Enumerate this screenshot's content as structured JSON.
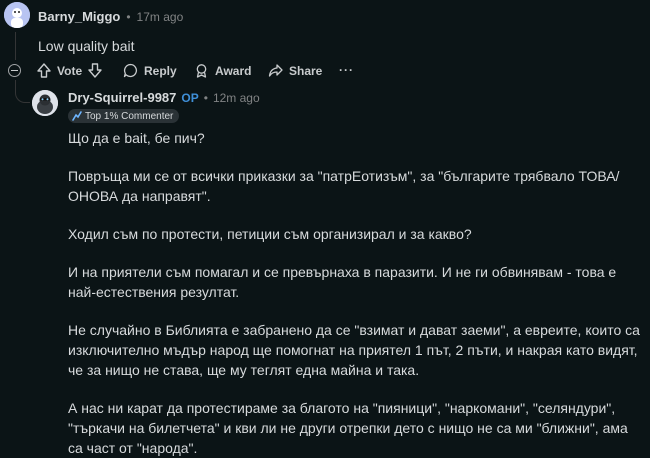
{
  "comment": {
    "author": "Barny_Miggo",
    "time": "17m ago",
    "body": "Low quality bait",
    "actions": {
      "vote": "Vote",
      "reply": "Reply",
      "award": "Award",
      "share": "Share",
      "more": "···"
    }
  },
  "reply": {
    "author": "Dry-Squirrel-9987",
    "op_badge": "OP",
    "time": "12m ago",
    "flair": "Top 1% Commenter",
    "paragraphs": [
      "Що да е bait, бе пич?",
      "Повръща ми се от всички приказки за \"патрЕотизъм\", за \"българите трябвало ТОВА/ОНОВА да направят\".",
      "Ходил съм по протести, петиции съм организирал и за какво?",
      "И на приятели съм помагал и се превърнаха в паразити. И не ги обвинявам - това е най-естествения резултат.",
      "Не случайно в Библията е забранено да се \"взимат и дават заеми\", а евреите, които са изключително мъдър народ ще помогнат на приятел 1 път, 2 пъти, и накрая като видят, че за нищо не става, ще му теглят една майна и така.",
      "А нас ни карат да протестираме за благото на \"пияници\", \"наркомани\", \"селяндури\", \"търкачи на билетчета\" и кви ли не други отрепки дето с нищо не са ми \"ближни\", ама са част от \"народа\"."
    ]
  },
  "colors": {
    "background": "#0b1416",
    "text": "#d7dadc",
    "meta": "#818384",
    "op": "#3f8fd8",
    "thread_line": "#343536"
  }
}
